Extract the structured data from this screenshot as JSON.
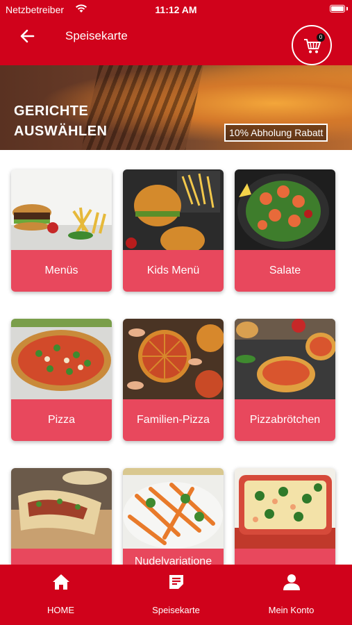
{
  "status_bar": {
    "carrier": "Netzbetreiber",
    "time": "11:12 AM"
  },
  "header": {
    "title": "Speisekarte",
    "cart_count": "0"
  },
  "banner": {
    "title_line1": "GERICHTE",
    "title_line2": "AUSWÄHLEN",
    "promo": "10% Abholung Rabatt"
  },
  "categories": [
    {
      "label": "Menüs"
    },
    {
      "label": "Kids Menü"
    },
    {
      "label": "Salate"
    },
    {
      "label": "Pizza"
    },
    {
      "label": "Familien-Pizza"
    },
    {
      "label": "Pizzabrötchen"
    },
    {
      "label": ""
    },
    {
      "label": "Nudelvariatione"
    },
    {
      "label": ""
    }
  ],
  "bottom_nav": [
    {
      "label": "HOME",
      "icon": "home-icon"
    },
    {
      "label": "Speisekarte",
      "icon": "menu-list-icon"
    },
    {
      "label": "Mein Konto",
      "icon": "user-icon"
    }
  ],
  "colors": {
    "brand_red": "#d0021b",
    "tile_label": "#e8485d"
  }
}
